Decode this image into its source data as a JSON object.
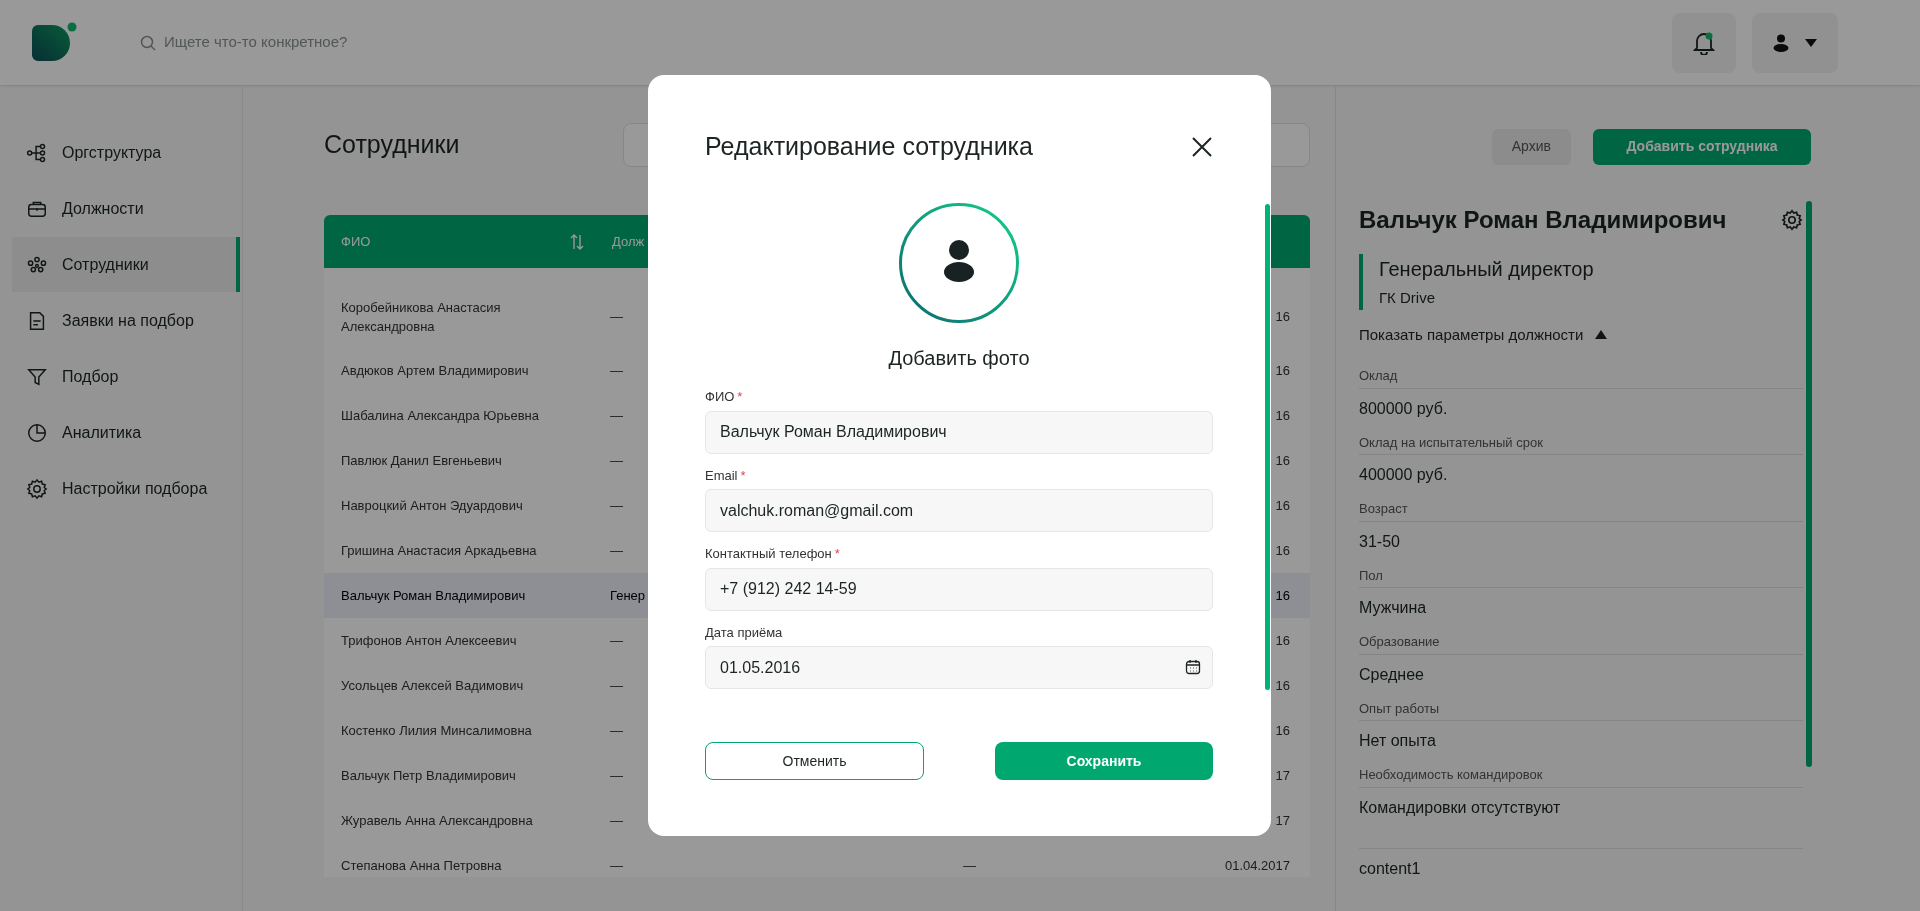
{
  "header": {
    "search_placeholder": "Ищете что-то конкретное?"
  },
  "sidebar": {
    "items": [
      {
        "label": "Оргструктура",
        "selected": false
      },
      {
        "label": "Должности",
        "selected": false
      },
      {
        "label": "Сотрудники",
        "selected": true
      },
      {
        "label": "Заявки на подбор",
        "selected": false
      },
      {
        "label": "Подбор",
        "selected": false
      },
      {
        "label": "Аналитика",
        "selected": false
      },
      {
        "label": "Настройки подбора",
        "selected": false
      }
    ]
  },
  "page": {
    "title": "Сотрудники",
    "archive_button": "Архив",
    "add_button": "Добавить сотрудника"
  },
  "table": {
    "columns": [
      {
        "label": "ФИО",
        "sortable": true
      },
      {
        "label": "Долж",
        "sortable": false
      }
    ],
    "rows": [
      {
        "name": "Коробейникова Анастасия Александровна",
        "position": "—",
        "column_3": "",
        "date": "16",
        "selected": false
      },
      {
        "name": "Авдюков Артем Владимирович",
        "position": "—",
        "column_3": "",
        "date": "16",
        "selected": false
      },
      {
        "name": "Шабалина Александра Юрьевна",
        "position": "—",
        "column_3": "",
        "date": "16",
        "selected": false
      },
      {
        "name": "Павлюк Данил Евгеньевич",
        "position": "—",
        "column_3": "",
        "date": "16",
        "selected": false
      },
      {
        "name": "Навроцкий Антон Эдуардович",
        "position": "—",
        "column_3": "",
        "date": "16",
        "selected": false
      },
      {
        "name": "Гришина Анастасия Аркадьевна",
        "position": "—",
        "column_3": "",
        "date": "16",
        "selected": false
      },
      {
        "name": "Вальчук Роман Владимирович",
        "position": "Генер",
        "column_3": "",
        "date": "16",
        "selected": true
      },
      {
        "name": "Трифонов Антон Алексеевич",
        "position": "—",
        "column_3": "",
        "date": "16",
        "selected": false
      },
      {
        "name": "Усольцев Алексей Вадимович",
        "position": "—",
        "column_3": "",
        "date": "16",
        "selected": false
      },
      {
        "name": "Костенко Лилия Минсалимовна",
        "position": "—",
        "column_3": "",
        "date": "16",
        "selected": false
      },
      {
        "name": "Вальчук Петр Владимирович",
        "position": "—",
        "column_3": "",
        "date": "17",
        "selected": false
      },
      {
        "name": "Журавель Анна Александровна",
        "position": "—",
        "column_3": "",
        "date": "17",
        "selected": false
      },
      {
        "name": "Степанова Анна Петровна",
        "position": "—",
        "column_3": "—",
        "date": "01.04.2017",
        "selected": false
      }
    ]
  },
  "details": {
    "name": "Вальчук Роман Владимирович",
    "position": "Генеральный директор",
    "company": "ГК Drive",
    "toggle": {
      "label": "Показать параметры должности",
      "expanded": true
    },
    "params": [
      {
        "label": "Оклад",
        "value": "800000 руб."
      },
      {
        "label": "Оклад на испытательный срок",
        "value": "400000 руб."
      },
      {
        "label": "Возраст",
        "value": "31-50"
      },
      {
        "label": "Пол",
        "value": "Мужчина"
      },
      {
        "label": "Образование",
        "value": "Среднее"
      },
      {
        "label": "Опыт работы",
        "value": "Нет опыта"
      },
      {
        "label": "Необходимость командировок",
        "value": "Командировки отсутствуют"
      },
      {
        "value": "content1"
      }
    ]
  },
  "modal": {
    "title": "Редактирование сотрудника",
    "photo_label": "Добавить фото",
    "fields": [
      {
        "label": "ФИО",
        "mark": "*",
        "value": "Вальчук Роман Владимирович",
        "kind": "text"
      },
      {
        "label": "Email",
        "mark": "*",
        "value": "valchuk.roman@gmail.com",
        "kind": "text"
      },
      {
        "label": "Контактный телефон",
        "mark": "*",
        "value": "+7 (912) 242 14-59",
        "kind": "text"
      },
      {
        "label": "Дата приёма",
        "value": "01.05.2016",
        "kind": "date"
      }
    ],
    "cancel_button": "Отменить",
    "save_button": "Сохранить"
  }
}
